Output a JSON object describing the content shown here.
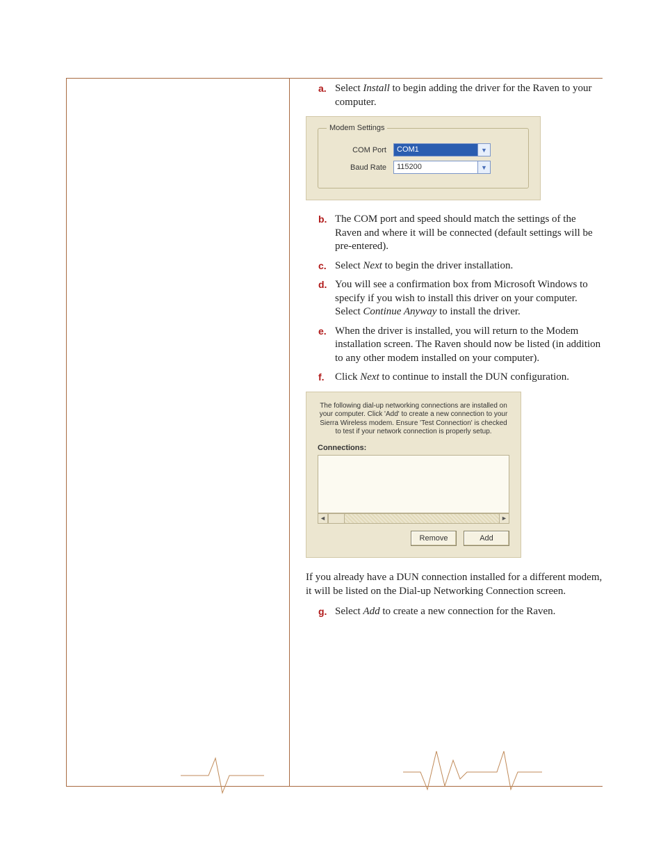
{
  "steps": {
    "a": {
      "letter": "a.",
      "pre": "Select ",
      "em": "Install",
      "post": " to begin adding the driver for the Raven to your computer."
    },
    "b": {
      "letter": "b.",
      "text": "The COM port and speed should match the settings of the Raven and where it will be connected (default settings will be pre-entered)."
    },
    "c": {
      "letter": "c.",
      "pre": "Select ",
      "em": "Next",
      "post": " to begin the driver installation."
    },
    "d": {
      "letter": "d.",
      "pre": "You will see a confirmation box from Microsoft Windows to specify if you wish to install this driver on your computer. Select ",
      "em": "Continue Anyway",
      "post": " to install the driver."
    },
    "e": {
      "letter": "e.",
      "text": "When the driver is installed, you will return to the Modem installation screen. The Raven should now be listed (in addition to any other modem installed on your computer)."
    },
    "f": {
      "letter": "f.",
      "pre": "Click ",
      "em": "Next",
      "post": " to continue to install the DUN configu­ration."
    },
    "g": {
      "letter": "g.",
      "pre": "Select ",
      "em": "Add",
      "post": " to create a new connection for the Raven."
    }
  },
  "paragraph_after_shot2": "If you already have a DUN connection installed for a different modem, it will be listed on the Dial-up Networking Connection screen.",
  "modem_settings": {
    "legend": "Modem Settings",
    "com_port_label": "COM Port",
    "com_port_value": "COM1",
    "baud_rate_label": "Baud Rate",
    "baud_rate_value": "115200"
  },
  "dun": {
    "intro": "The following dial-up networking connections are installed on your computer. Click 'Add' to create a new connection to your Sierra Wireless modem. Ensure 'Test Connection' is checked to test if your network connection is properly setup.",
    "connections_label": "Connections:",
    "remove_label": "Remove",
    "add_label": "Add"
  },
  "icons": {
    "chevron_down": "▼",
    "scroll_left": "◄",
    "scroll_right": "►"
  }
}
